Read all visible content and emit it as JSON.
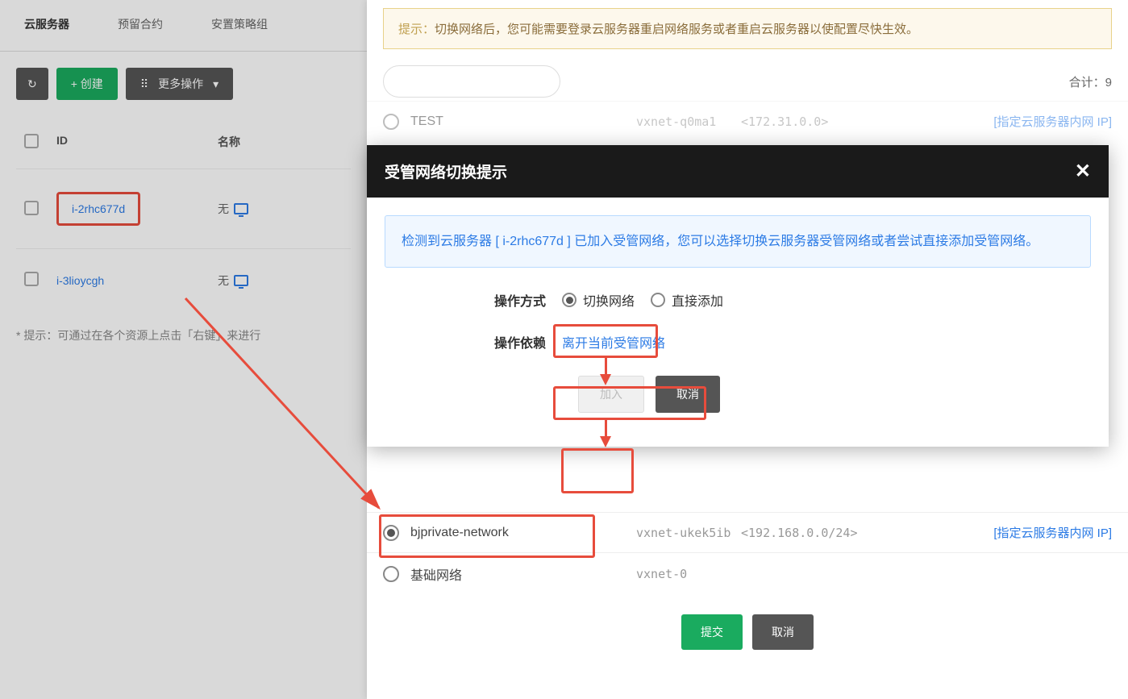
{
  "tabs": {
    "vm": "云服务器",
    "reserved": "预留合约",
    "placement": "安置策略组"
  },
  "toolbar": {
    "create": "+ 创建",
    "more": "更多操作"
  },
  "table": {
    "headers": {
      "id": "ID",
      "name": "名称"
    },
    "rows": [
      {
        "id": "i-2rhc677d",
        "name": "无"
      },
      {
        "id": "i-3lioycgh",
        "name": "无"
      }
    ]
  },
  "bottom_hint": "* 提示：可通过在各个资源上点击「右键」来进行",
  "drawer": {
    "warning_prefix": "提示：",
    "warning_text": "切换网络后，您可能需要登录云服务器重启网络服务或者重启云服务器以使配置尽快生效。",
    "total_label": "合计：",
    "total_count": "9",
    "rows": [
      {
        "name": "TEST",
        "id": "vxnet-q0ma1",
        "cidr": "<172.31.0.0>",
        "action": "[指定云服务器内网 IP]",
        "selected": false
      },
      {
        "name": "bjprivate-network",
        "id": "vxnet-ukek5ib",
        "cidr": "<192.168.0.0/24>",
        "action": "[指定云服务器内网 IP]",
        "selected": true
      },
      {
        "name": "基础网络",
        "id": "vxnet-0",
        "cidr": "",
        "action": "",
        "selected": false
      }
    ],
    "submit": "提交",
    "cancel": "取消"
  },
  "modal": {
    "title": "受管网络切换提示",
    "info": "检测到云服务器 [ i-2rhc677d ] 已加入受管网络，您可以选择切换云服务器受管网络或者尝试直接添加受管网络。",
    "op_mode_label": "操作方式",
    "op_switch": "切换网络",
    "op_direct": "直接添加",
    "op_depend_label": "操作依赖",
    "leave_link": "离开当前受管网络",
    "join": "加入",
    "cancel": "取消"
  }
}
